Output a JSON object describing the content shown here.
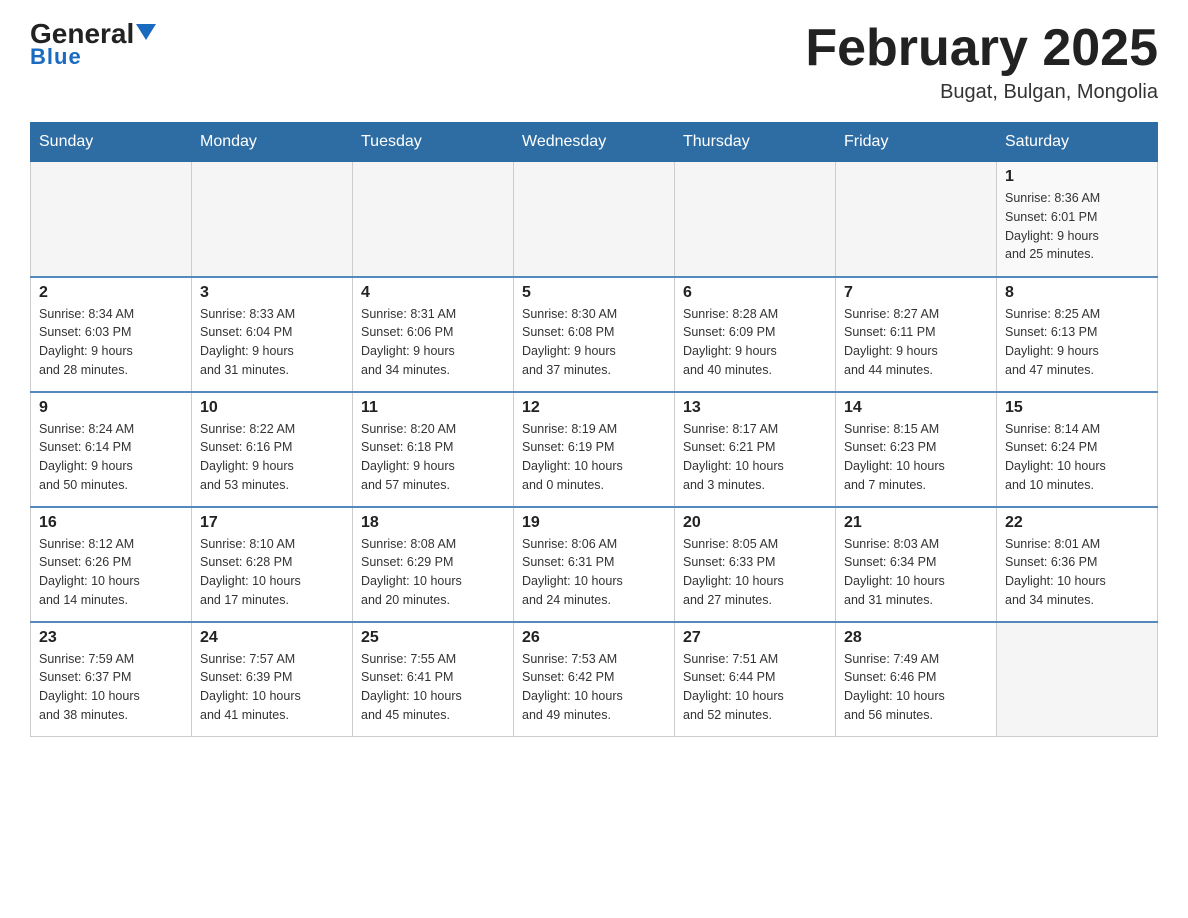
{
  "header": {
    "logo_general": "General",
    "logo_blue": "Blue",
    "month_title": "February 2025",
    "location": "Bugat, Bulgan, Mongolia"
  },
  "weekdays": [
    "Sunday",
    "Monday",
    "Tuesday",
    "Wednesday",
    "Thursday",
    "Friday",
    "Saturday"
  ],
  "weeks": [
    [
      {
        "day": "",
        "info": ""
      },
      {
        "day": "",
        "info": ""
      },
      {
        "day": "",
        "info": ""
      },
      {
        "day": "",
        "info": ""
      },
      {
        "day": "",
        "info": ""
      },
      {
        "day": "",
        "info": ""
      },
      {
        "day": "1",
        "info": "Sunrise: 8:36 AM\nSunset: 6:01 PM\nDaylight: 9 hours\nand 25 minutes."
      }
    ],
    [
      {
        "day": "2",
        "info": "Sunrise: 8:34 AM\nSunset: 6:03 PM\nDaylight: 9 hours\nand 28 minutes."
      },
      {
        "day": "3",
        "info": "Sunrise: 8:33 AM\nSunset: 6:04 PM\nDaylight: 9 hours\nand 31 minutes."
      },
      {
        "day": "4",
        "info": "Sunrise: 8:31 AM\nSunset: 6:06 PM\nDaylight: 9 hours\nand 34 minutes."
      },
      {
        "day": "5",
        "info": "Sunrise: 8:30 AM\nSunset: 6:08 PM\nDaylight: 9 hours\nand 37 minutes."
      },
      {
        "day": "6",
        "info": "Sunrise: 8:28 AM\nSunset: 6:09 PM\nDaylight: 9 hours\nand 40 minutes."
      },
      {
        "day": "7",
        "info": "Sunrise: 8:27 AM\nSunset: 6:11 PM\nDaylight: 9 hours\nand 44 minutes."
      },
      {
        "day": "8",
        "info": "Sunrise: 8:25 AM\nSunset: 6:13 PM\nDaylight: 9 hours\nand 47 minutes."
      }
    ],
    [
      {
        "day": "9",
        "info": "Sunrise: 8:24 AM\nSunset: 6:14 PM\nDaylight: 9 hours\nand 50 minutes."
      },
      {
        "day": "10",
        "info": "Sunrise: 8:22 AM\nSunset: 6:16 PM\nDaylight: 9 hours\nand 53 minutes."
      },
      {
        "day": "11",
        "info": "Sunrise: 8:20 AM\nSunset: 6:18 PM\nDaylight: 9 hours\nand 57 minutes."
      },
      {
        "day": "12",
        "info": "Sunrise: 8:19 AM\nSunset: 6:19 PM\nDaylight: 10 hours\nand 0 minutes."
      },
      {
        "day": "13",
        "info": "Sunrise: 8:17 AM\nSunset: 6:21 PM\nDaylight: 10 hours\nand 3 minutes."
      },
      {
        "day": "14",
        "info": "Sunrise: 8:15 AM\nSunset: 6:23 PM\nDaylight: 10 hours\nand 7 minutes."
      },
      {
        "day": "15",
        "info": "Sunrise: 8:14 AM\nSunset: 6:24 PM\nDaylight: 10 hours\nand 10 minutes."
      }
    ],
    [
      {
        "day": "16",
        "info": "Sunrise: 8:12 AM\nSunset: 6:26 PM\nDaylight: 10 hours\nand 14 minutes."
      },
      {
        "day": "17",
        "info": "Sunrise: 8:10 AM\nSunset: 6:28 PM\nDaylight: 10 hours\nand 17 minutes."
      },
      {
        "day": "18",
        "info": "Sunrise: 8:08 AM\nSunset: 6:29 PM\nDaylight: 10 hours\nand 20 minutes."
      },
      {
        "day": "19",
        "info": "Sunrise: 8:06 AM\nSunset: 6:31 PM\nDaylight: 10 hours\nand 24 minutes."
      },
      {
        "day": "20",
        "info": "Sunrise: 8:05 AM\nSunset: 6:33 PM\nDaylight: 10 hours\nand 27 minutes."
      },
      {
        "day": "21",
        "info": "Sunrise: 8:03 AM\nSunset: 6:34 PM\nDaylight: 10 hours\nand 31 minutes."
      },
      {
        "day": "22",
        "info": "Sunrise: 8:01 AM\nSunset: 6:36 PM\nDaylight: 10 hours\nand 34 minutes."
      }
    ],
    [
      {
        "day": "23",
        "info": "Sunrise: 7:59 AM\nSunset: 6:37 PM\nDaylight: 10 hours\nand 38 minutes."
      },
      {
        "day": "24",
        "info": "Sunrise: 7:57 AM\nSunset: 6:39 PM\nDaylight: 10 hours\nand 41 minutes."
      },
      {
        "day": "25",
        "info": "Sunrise: 7:55 AM\nSunset: 6:41 PM\nDaylight: 10 hours\nand 45 minutes."
      },
      {
        "day": "26",
        "info": "Sunrise: 7:53 AM\nSunset: 6:42 PM\nDaylight: 10 hours\nand 49 minutes."
      },
      {
        "day": "27",
        "info": "Sunrise: 7:51 AM\nSunset: 6:44 PM\nDaylight: 10 hours\nand 52 minutes."
      },
      {
        "day": "28",
        "info": "Sunrise: 7:49 AM\nSunset: 6:46 PM\nDaylight: 10 hours\nand 56 minutes."
      },
      {
        "day": "",
        "info": ""
      }
    ]
  ]
}
